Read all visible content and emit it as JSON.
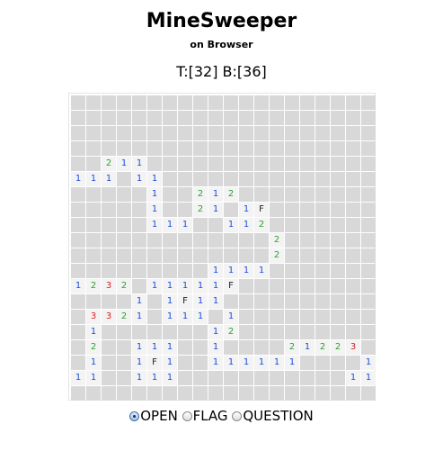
{
  "header": {
    "title": "MineSweeper",
    "subtitle": "on Browser",
    "status": "T:[32] B:[36]"
  },
  "modes": [
    {
      "label": "OPEN",
      "checked": true
    },
    {
      "label": "FLAG",
      "checked": false
    },
    {
      "label": "QUESTION",
      "checked": false
    }
  ],
  "colors": {
    "closed_cell": "#d8d8d8",
    "open_cell": "#f3f3f3",
    "number_1": "#1c4ddc",
    "number_2": "#2ca22c",
    "number_3": "#e02020"
  },
  "board": {
    "rows": 20,
    "cols": 20,
    "legend": "# = closed, . = open empty, digit = open number, F = flag",
    "grid": [
      "####################",
      "####################",
      "####################",
      "####################",
      "##211###############",
      "111#11##############",
      "#####1##212#########",
      "#####1##21#1F#######",
      "#####111##112#######",
      "#############2######",
      "#############2######",
      "#########1111#######",
      "1232#11111F#########",
      "####1#1F11##########",
      "#3321#111#1#########",
      "#1#######12#########",
      "#2##111##1####21223#",
      "#1##1F1##111111####1",
      "11##111###########11",
      "####################"
    ]
  }
}
